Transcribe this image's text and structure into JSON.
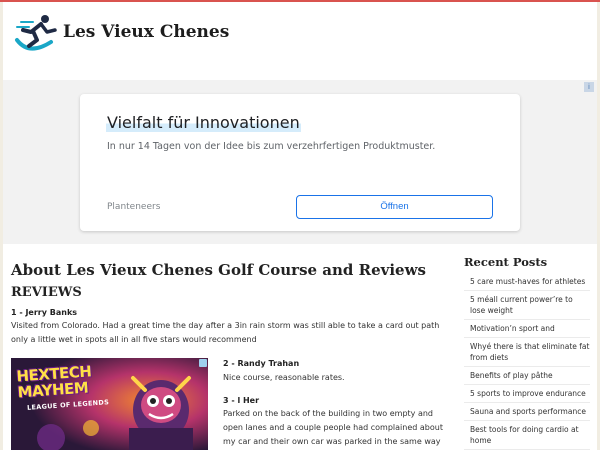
{
  "site": {
    "name": "Les Vieux Chenes",
    "accent": "#d9534f",
    "logo_colors": [
      "#1f2a44",
      "#1aa7c7"
    ]
  },
  "ad": {
    "headline": "Vielfalt für Innovationen",
    "subline": "In nur 14 Tagen von der Idee bis zum verzehrfertigen Produktmuster.",
    "advertiser": "Planteneers",
    "cta_label": "Öffnen",
    "badge": "i",
    "cta_color": "#1a73e8"
  },
  "article": {
    "title": "About Les Vieux Chenes Golf Course and Reviews",
    "section": "REVIEWS",
    "reviews": [
      {
        "name": "1 - Jerry Banks",
        "text": "Visited from Colorado. Had a great time the day after a 3in rain storm was still able to take a card out path only a little wet in spots all in all five stars would recommend"
      },
      {
        "name": "2 - Randy Trahan",
        "text": "Nice course, reasonable rates."
      },
      {
        "name": "3 - l Her",
        "text": "Parked on the back of the building in two empty and open lanes and a couple people had complained about my car and their own car was parked in the same way that i had."
      }
    ]
  },
  "game_ad": {
    "title": "HEXTECH MAYHEM",
    "subtitle": "LEAGUE OF LEGENDS"
  },
  "sidebar": {
    "title": "Recent Posts",
    "items": [
      "5 care must-haves for athletes",
      "5 méall current power’re to lose weight",
      "Motivation’n sport and",
      "Whyé there is that eliminate fat from diets",
      "Benefits of play pâthe",
      "5 sports to improve endurance",
      "Sauna and sports performance",
      "Best tools for doing cardio at home"
    ]
  }
}
